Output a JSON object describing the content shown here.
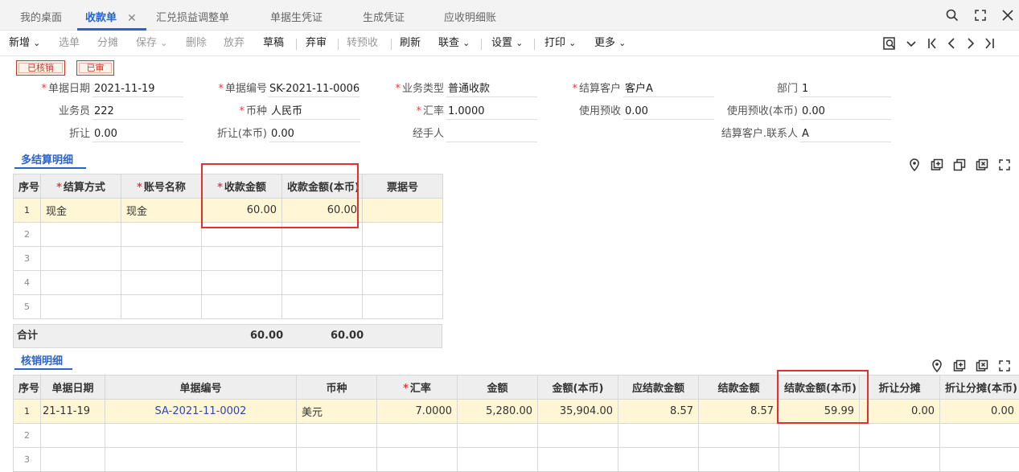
{
  "tabs": [
    {
      "label": "我的桌面",
      "active": false
    },
    {
      "label": "收款单",
      "active": true
    },
    {
      "label": "汇兑损益调整单",
      "active": false
    },
    {
      "label": "单据生凭证",
      "active": false
    },
    {
      "label": "生成凭证",
      "active": false
    },
    {
      "label": "应收明细账",
      "active": false
    }
  ],
  "tab_close": "✕",
  "toolbar": {
    "items": [
      {
        "label": "新增",
        "arrow": "⌄",
        "disabled": false
      },
      {
        "label": "选单",
        "disabled": true
      },
      {
        "label": "分摊",
        "disabled": true
      },
      {
        "label": "保存",
        "arrow": "⌄",
        "disabled": true
      },
      {
        "label": "删除",
        "disabled": true
      },
      {
        "label": "放弃",
        "disabled": true
      },
      {
        "label": "草稿",
        "disabled": false
      },
      {
        "label": "弃审",
        "disabled": false
      },
      {
        "label": "转预收",
        "disabled": true
      },
      {
        "label": "刷新",
        "disabled": false
      },
      {
        "label": "联查",
        "arrow": "⌄",
        "disabled": false
      },
      {
        "label": "设置",
        "arrow": "⌄",
        "disabled": false
      },
      {
        "label": "打印",
        "arrow": "⌄",
        "disabled": false
      },
      {
        "label": "更多",
        "arrow": "⌄",
        "disabled": false
      }
    ]
  },
  "badges": {
    "verified": "已核销",
    "audited": "已审"
  },
  "form": {
    "doc_date": {
      "label": "单据日期",
      "value": "2021-11-19"
    },
    "doc_no": {
      "label": "单据编号",
      "value": "SK-2021-11-0006"
    },
    "biz_type": {
      "label": "业务类型",
      "value": "普通收款"
    },
    "customer": {
      "label": "结算客户",
      "value": "客户A"
    },
    "dept": {
      "label": "部门",
      "value": "1"
    },
    "salesman": {
      "label": "业务员",
      "value": "222"
    },
    "currency": {
      "label": "币种",
      "value": "人民币"
    },
    "rate": {
      "label": "汇率",
      "value": "1.0000"
    },
    "use_prepay": {
      "label": "使用预收",
      "value": "0.00"
    },
    "use_prepay_local": {
      "label": "使用预收(本币)",
      "value": "0.00"
    },
    "discount": {
      "label": "折让",
      "value": "0.00"
    },
    "discount_local": {
      "label": "折让(本币)",
      "value": "0.00"
    },
    "handler": {
      "label": "经手人",
      "value": ""
    },
    "contact": {
      "label": "结算客户.联系人",
      "value": "A"
    }
  },
  "settle": {
    "title": "多结算明细",
    "headers": [
      {
        "label": "序号",
        "required": false
      },
      {
        "label": "结算方式",
        "required": true
      },
      {
        "label": "账号名称",
        "required": true
      },
      {
        "label": "收款金额",
        "required": true
      },
      {
        "label": "收款金额(本币)",
        "required": false
      },
      {
        "label": "票据号",
        "required": false
      }
    ],
    "rows": [
      {
        "idx": "1",
        "method": "现金",
        "account": "现金",
        "amount": "60.00",
        "amount_local": "60.00",
        "bill_no": ""
      },
      {
        "idx": "2"
      },
      {
        "idx": "3"
      },
      {
        "idx": "4"
      },
      {
        "idx": "5"
      }
    ],
    "total_label": "合计",
    "total_amount": "60.00",
    "total_amount_local": "60.00"
  },
  "verify": {
    "title": "核销明细",
    "headers": [
      {
        "label": "序号",
        "required": false
      },
      {
        "label": "单据日期",
        "required": false
      },
      {
        "label": "单据编号",
        "required": false
      },
      {
        "label": "币种",
        "required": false
      },
      {
        "label": "汇率",
        "required": true
      },
      {
        "label": "金额",
        "required": false
      },
      {
        "label": "金额(本币)",
        "required": false
      },
      {
        "label": "应结款金额",
        "required": false
      },
      {
        "label": "结款金额",
        "required": false
      },
      {
        "label": "结款金额(本币)",
        "required": false
      },
      {
        "label": "折让分摊",
        "required": false
      },
      {
        "label": "折让分摊(本币)",
        "required": false
      }
    ],
    "rows": [
      {
        "idx": "1",
        "date": "21-11-19",
        "doc_no": "SA-2021-11-0002",
        "currency": "美元",
        "rate": "7.0000",
        "amount": "5,280.00",
        "amount_local": "35,904.00",
        "due": "8.57",
        "settled": "8.57",
        "settled_local": "59.99",
        "disc": "0.00",
        "disc_local": "0.00"
      },
      {
        "idx": "2"
      },
      {
        "idx": "3"
      }
    ]
  },
  "colors": {
    "accent": "#2d63c8",
    "highlight": "#e0312f",
    "selected_row": "#fff6d5"
  }
}
